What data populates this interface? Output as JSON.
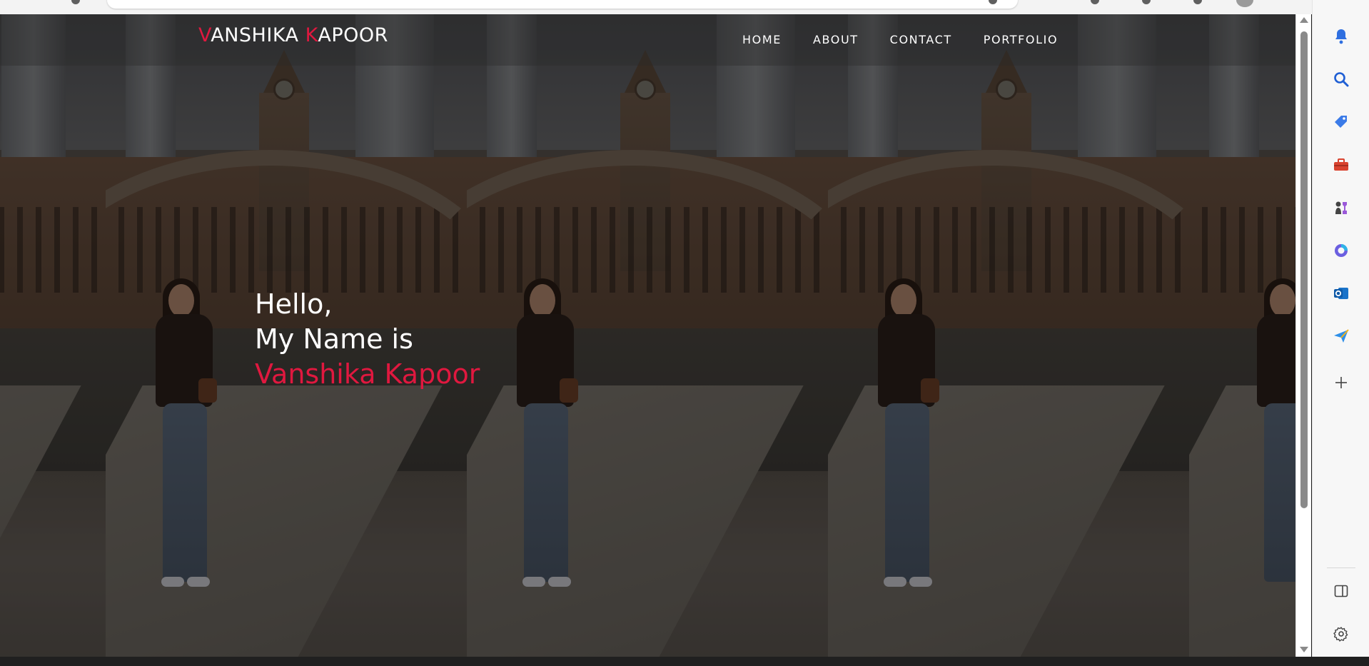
{
  "site": {
    "brand_first_initial": "V",
    "brand_first_rest": "ANSHIKA ",
    "brand_last_initial": "K",
    "brand_last_rest": "APOOR",
    "accent_color": "#e0183f"
  },
  "nav": {
    "items": [
      {
        "label": "HOME"
      },
      {
        "label": "ABOUT"
      },
      {
        "label": "CONTACT"
      },
      {
        "label": "PORTFOLIO"
      }
    ]
  },
  "hero": {
    "greeting": "Hello,",
    "intro": "My Name is",
    "name": "Vanshika Kapoor"
  },
  "browser_sidebar": {
    "icons": [
      "bell-icon",
      "search-icon",
      "tag-icon",
      "toolbox-icon",
      "chess-icon",
      "copilot-icon",
      "outlook-icon",
      "send-icon",
      "add-icon",
      "split-screen-icon",
      "settings-icon"
    ]
  }
}
